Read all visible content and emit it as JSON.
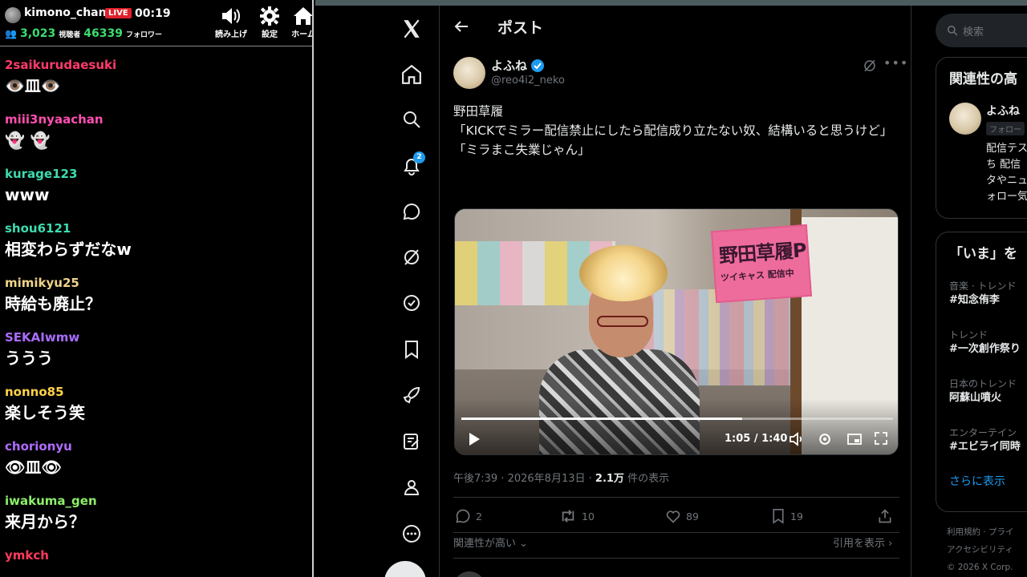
{
  "stream": {
    "channel_name": "kimono_chan",
    "live_label": "LIVE",
    "elapsed": "00:19",
    "viewers": "3,023",
    "viewers_label": "視聴者",
    "followers": "46339",
    "followers_label": "フォロワー",
    "buttons": [
      {
        "label": "読み上げ",
        "icon": "speaker-icon"
      },
      {
        "label": "設定",
        "icon": "gear-icon"
      },
      {
        "label": "ホーム",
        "icon": "home-icon"
      }
    ],
    "messages": [
      {
        "user": "2saikurudaesuki",
        "color": "#ff3b6b",
        "text": "👁️皿👁️"
      },
      {
        "user": "miii3nyaachan",
        "color": "#ff4fb0",
        "text": "👻 👻"
      },
      {
        "user": "kurage123",
        "color": "#3ddcb0",
        "text": "www"
      },
      {
        "user": "shou6121",
        "color": "#3ddcb0",
        "text": "相変わらずだなw"
      },
      {
        "user": "mimikyu25",
        "color": "#f1d48a",
        "text": "時給も廃止？"
      },
      {
        "user": "SEKAIwmw",
        "color": "#a86cff",
        "text": "ううう"
      },
      {
        "user": "nonno85",
        "color": "#ffd24a",
        "text": "楽しそう笑"
      },
      {
        "user": "chorionyu",
        "color": "#b06cff",
        "text": "👁皿👁"
      },
      {
        "user": "iwakuma_gen",
        "color": "#8cf06a",
        "text": "来月から？"
      },
      {
        "user": "ymkch",
        "color": "#ff3b5b",
        "text": ""
      }
    ]
  },
  "x": {
    "nav_icons": [
      "x-logo-icon",
      "home-icon",
      "search-icon",
      "bell-icon",
      "messages-icon",
      "grok-icon",
      "verified-icon",
      "bookmark-icon",
      "rocket-icon",
      "compose-icon",
      "profile-icon",
      "more-icon"
    ],
    "notification_count": "2",
    "header_title": "ポスト",
    "post": {
      "display_name": "よふね",
      "handle": "@reo4i2_neko",
      "lines": [
        "野田草履",
        "「KICKでミラー配信禁止にしたら配信成り立たない奴、結構いると思うけど」",
        "",
        "「ミラまこ失業じゃん」"
      ],
      "video": {
        "sign_big": "野田草履P",
        "sign_small": "ツイキャス 配信中",
        "time": "1:05 / 1:40",
        "progress": 0.65
      },
      "timestamp": "午後7:39 · 2026年8月13日 ·",
      "views": "2.1万",
      "views_label": "件の表示",
      "replies": "2",
      "reposts": "10",
      "likes": "89",
      "bookmarks": "19",
      "sort_label": "関連性が高い",
      "quotes_label": "引用を表示"
    },
    "sidebar": {
      "search_placeholder": "検索",
      "relevant_title": "関連性の高",
      "relevant_user_name": "よふね",
      "relevant_follow_badge": "フォロー",
      "relevant_bio": "配信テス\nち 配信\nタやニュ\nォロー気",
      "trends_title": "「いま」を",
      "trends": [
        {
          "category": "音楽 · トレンド",
          "name": "#知念侑李"
        },
        {
          "category": "トレンド",
          "name": "#一次創作祭り"
        },
        {
          "category": "日本のトレンド",
          "name": "阿蘇山噴火"
        },
        {
          "category": "エンターテイン",
          "name": "#エビライ同時"
        }
      ],
      "show_more": "さらに表示",
      "footer": [
        "利用規約 · プライ",
        "アクセシビリティ",
        "© 2026 X Corp."
      ]
    }
  }
}
